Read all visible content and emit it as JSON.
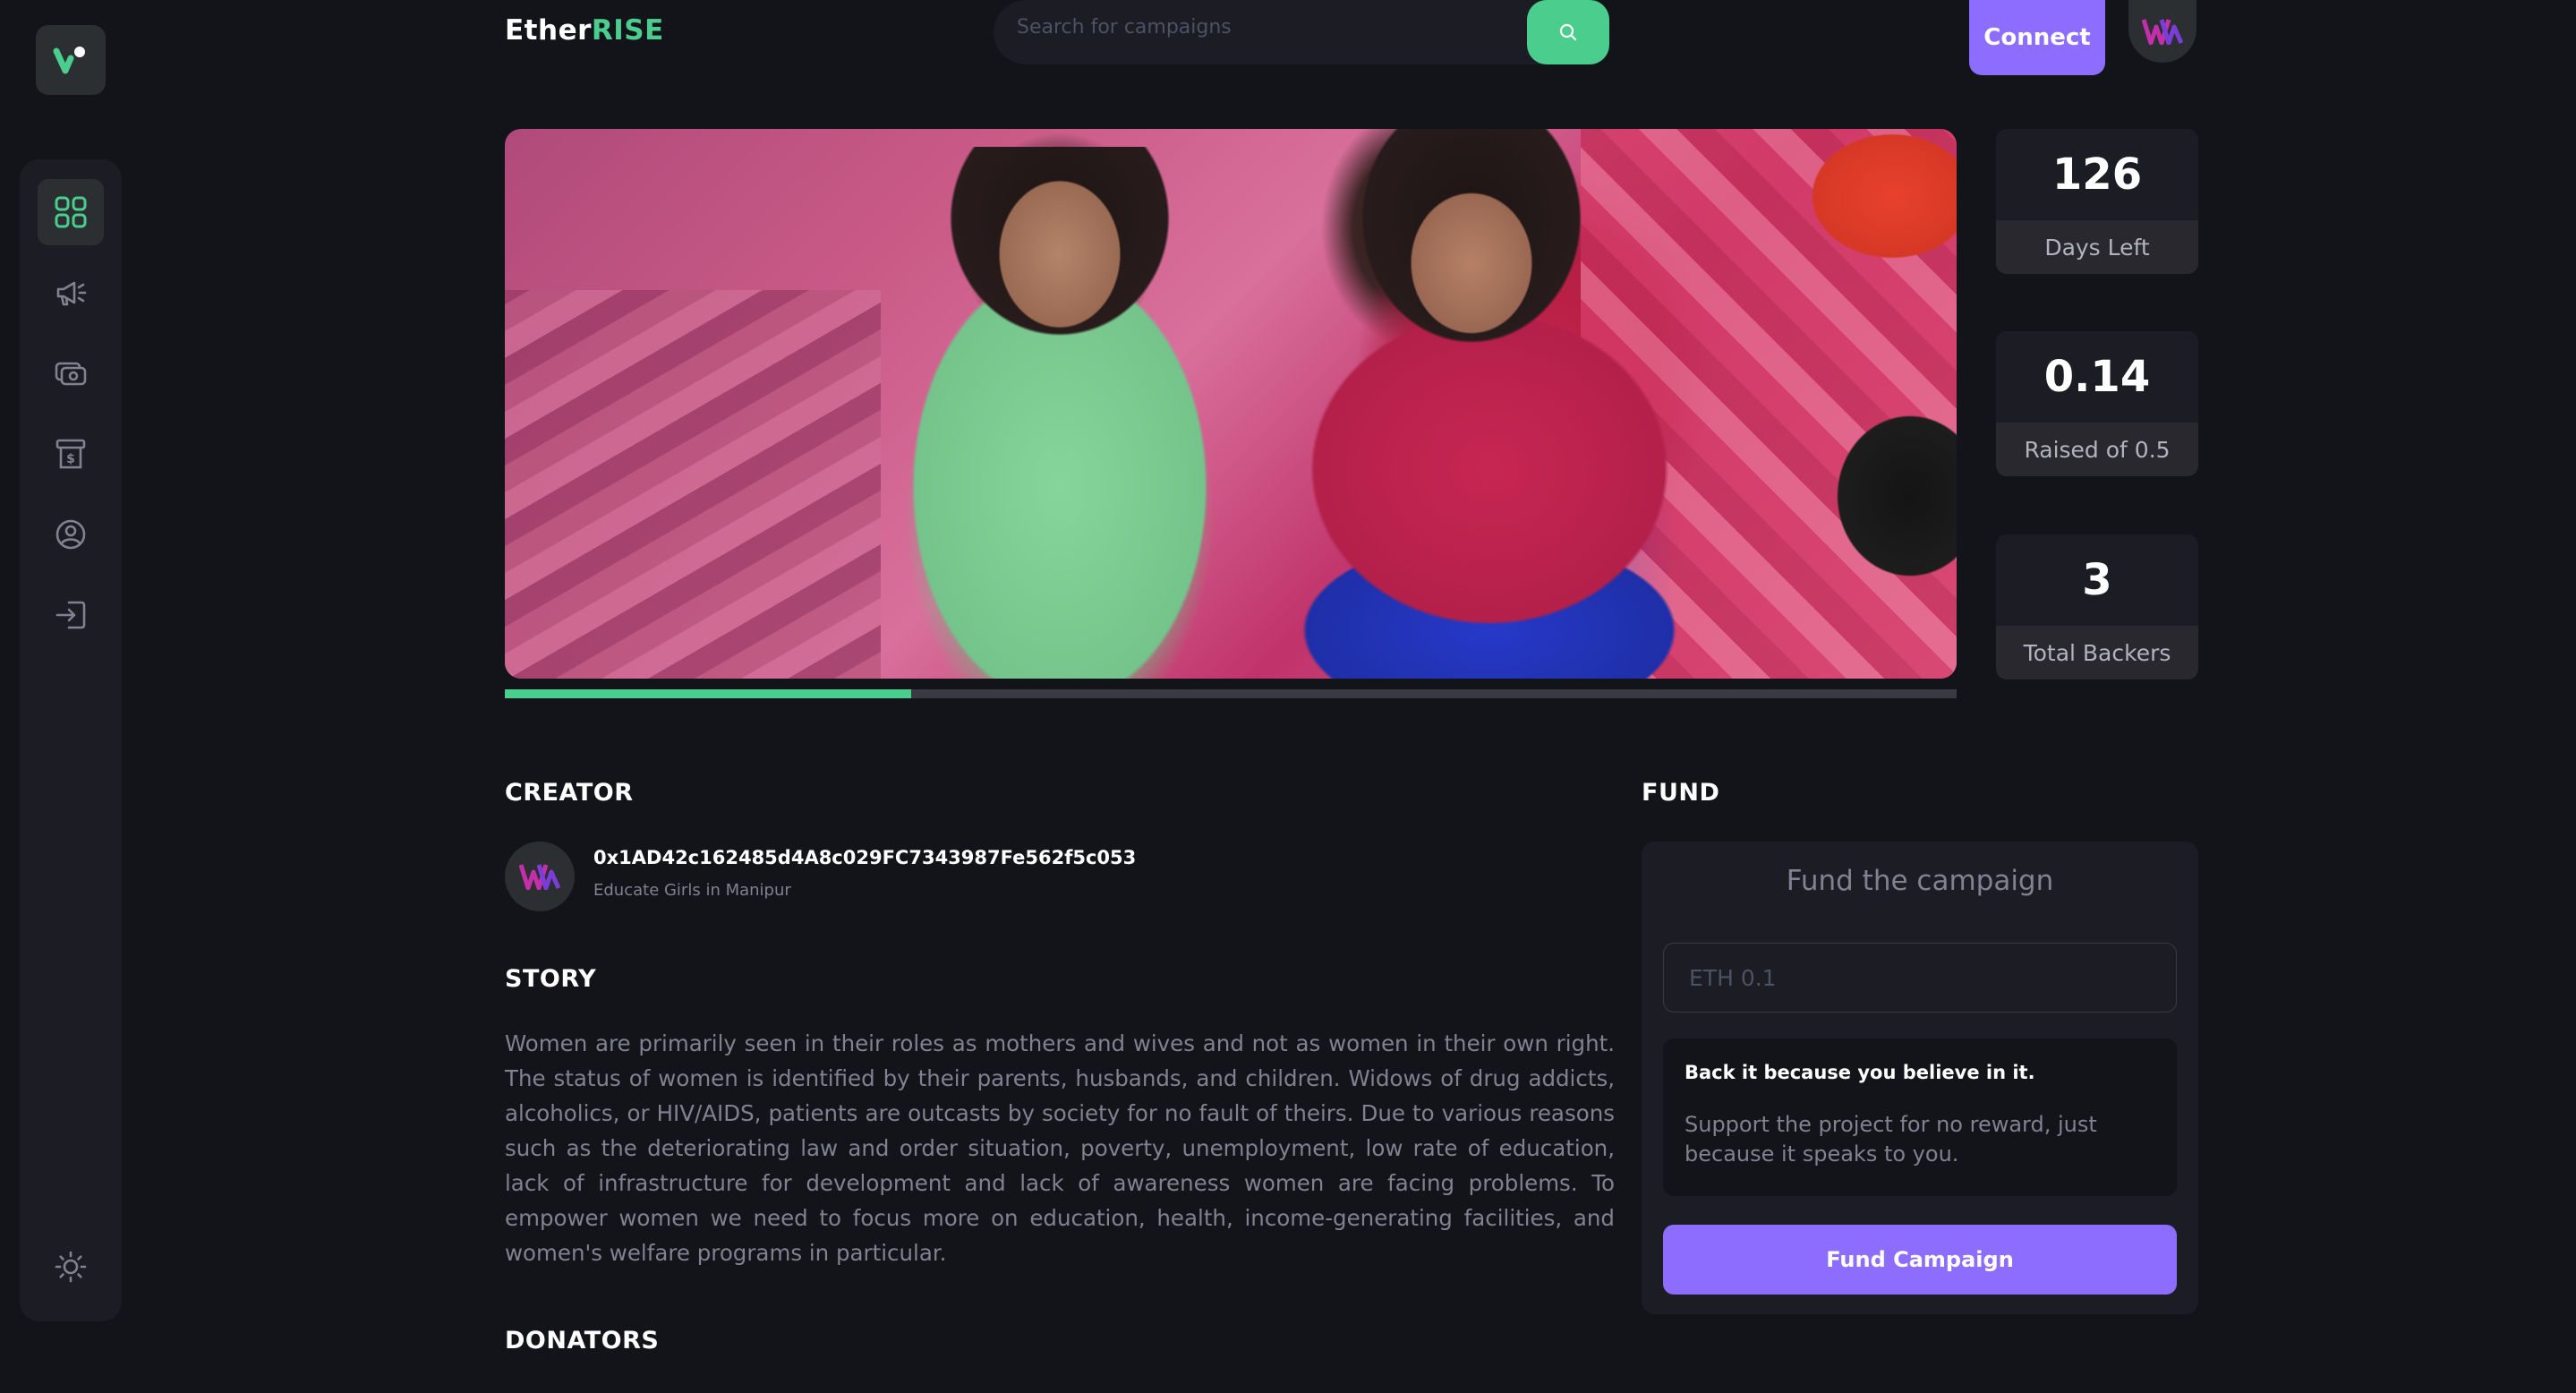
{
  "brand": {
    "part1": "Ether",
    "part2": "RISE"
  },
  "search": {
    "placeholder": "Search for campaigns"
  },
  "header": {
    "connect_label": "Connect"
  },
  "sidebar": {
    "items": [
      {
        "name": "dashboard",
        "icon": "dashboard-icon"
      },
      {
        "name": "campaign",
        "icon": "megaphone-icon"
      },
      {
        "name": "payment",
        "icon": "payment-icon"
      },
      {
        "name": "withdraw",
        "icon": "withdraw-icon"
      },
      {
        "name": "profile",
        "icon": "profile-icon"
      },
      {
        "name": "logout",
        "icon": "logout-icon"
      }
    ],
    "theme_icon": "sun-icon"
  },
  "campaign": {
    "progress_fraction": 0.28,
    "stats": [
      {
        "value": "126",
        "label": "Days Left"
      },
      {
        "value": "0.14",
        "label": "Raised of 0.5"
      },
      {
        "value": "3",
        "label": "Total Backers"
      }
    ]
  },
  "creator": {
    "heading": "CREATOR",
    "address": "0x1AD42c162485d4A8c029FC7343987Fe562f5c053",
    "campaign_title": "Educate Girls in Manipur"
  },
  "story": {
    "heading": "STORY",
    "text": "Women are primarily seen in their roles as mothers and wives and not as women in their own right. The status of women is identified by their parents, husbands, and children. Widows of drug addicts, alcoholics, or HIV/AIDS, patients are outcasts by society for no fault of theirs. Due to various reasons such as the deteriorating law and order situation, poverty, unemployment, low rate of education, lack of infrastructure for development and lack of awareness women are facing problems. To empower women we need to focus more on education, health, income-generating facilities, and women's welfare programs in particular."
  },
  "donators": {
    "heading": "DONATORS"
  },
  "fund": {
    "heading": "FUND",
    "title": "Fund the campaign",
    "input_placeholder": "ETH 0.1",
    "believe_title": "Back it because you believe in it.",
    "believe_text": "Support the project for no reward, just because it speaks to you.",
    "button_label": "Fund Campaign"
  },
  "colors": {
    "accent_green": "#4acd8d",
    "accent_purple": "#8c6dfd",
    "background": "#13131a",
    "panel": "#1c1c24"
  }
}
